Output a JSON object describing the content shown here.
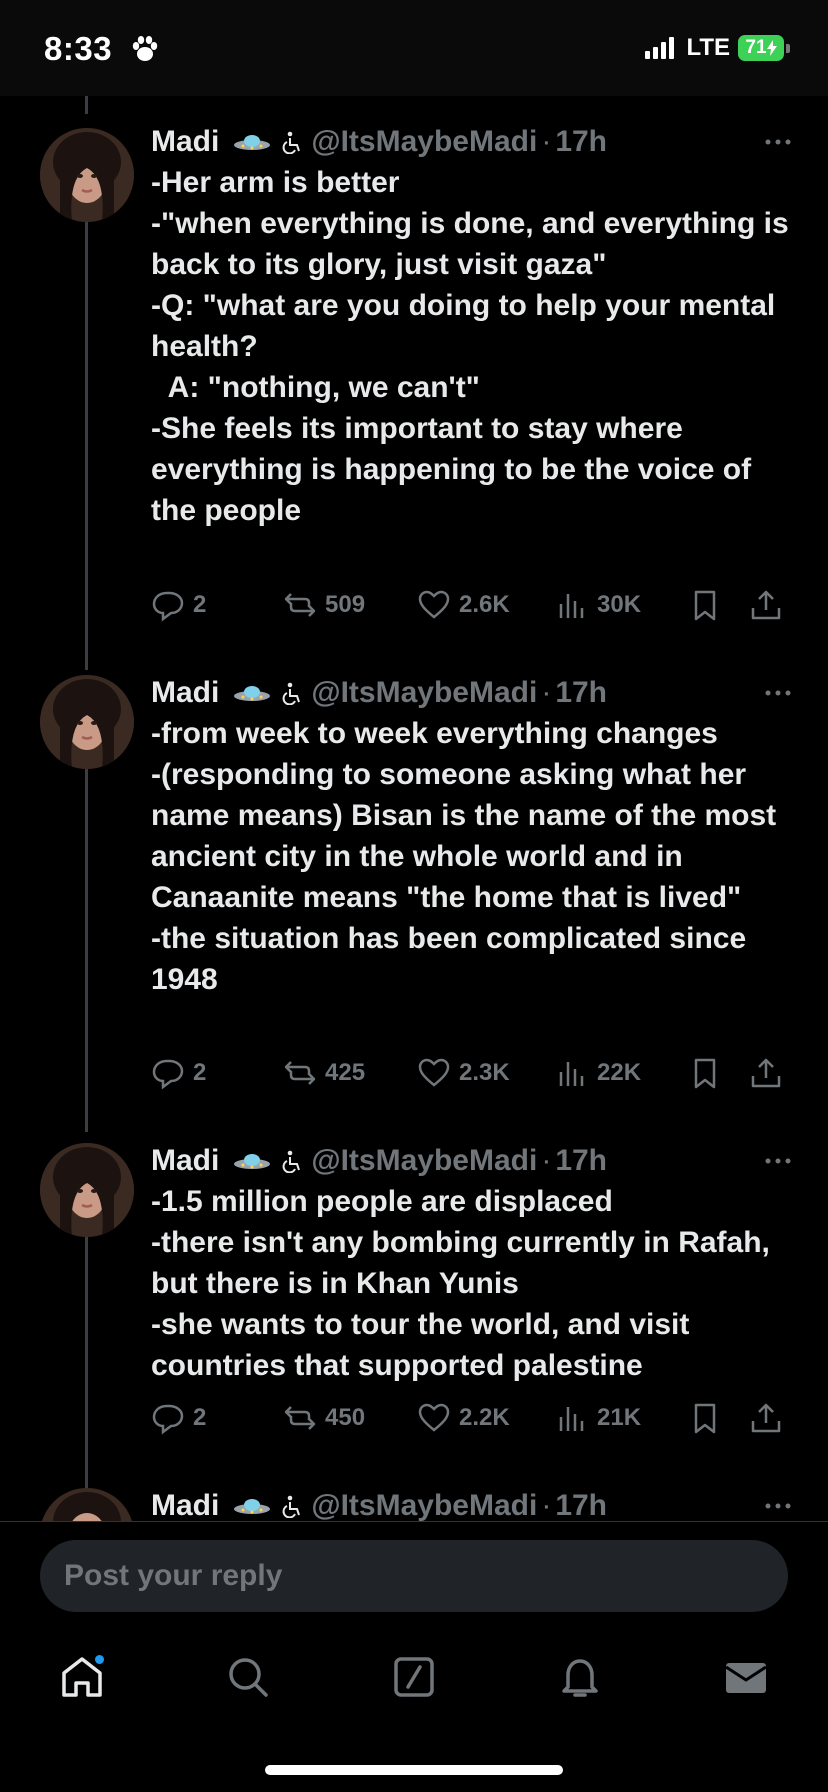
{
  "status_bar": {
    "time": "8:33",
    "network": "LTE",
    "battery": "71",
    "battery_color": "#3dd158"
  },
  "tweets": [
    {
      "name": "Madi",
      "handle": "@ItsMaybeMadi",
      "dot": "·",
      "time": "17h",
      "text": "-Her arm is better\n-\"when everything is done, and everything is back to its glory, just visit gaza\"\n-Q: \"what are you doing to help your mental health?\n  A: \"nothing, we can't\"\n-She feels its important to stay where everything is happening to be the voice of the people",
      "replies": "2",
      "reposts": "509",
      "likes": "2.6K",
      "views": "30K"
    },
    {
      "name": "Madi",
      "handle": "@ItsMaybeMadi",
      "dot": "·",
      "time": "17h",
      "text": "-from week to week everything changes\n-(responding to someone asking what her name means) Bisan is the name of the most ancient city in the whole world and in Canaanite means \"the home that is lived\"\n-the situation has been complicated since 1948",
      "replies": "2",
      "reposts": "425",
      "likes": "2.3K",
      "views": "22K"
    },
    {
      "name": "Madi",
      "handle": "@ItsMaybeMadi",
      "dot": "·",
      "time": "17h",
      "text": "-1.5 million people are displaced\n-there isn't any bombing currently in Rafah, but there is in Khan Yunis\n-she wants to tour the world, and visit countries that supported palestine",
      "replies": "2",
      "reposts": "450",
      "likes": "2.2K",
      "views": "21K"
    },
    {
      "name": "Madi",
      "handle": "@ItsMaybeMadi",
      "dot": "·",
      "time": "17h"
    }
  ],
  "reply": {
    "placeholder": "Post your reply"
  },
  "tabs": [
    "home-icon",
    "search-icon",
    "compose-icon",
    "notifications-icon",
    "messages-icon"
  ],
  "colors": {
    "background": "#000000",
    "muted": "#71767b",
    "accent": "#1d9bf0"
  }
}
